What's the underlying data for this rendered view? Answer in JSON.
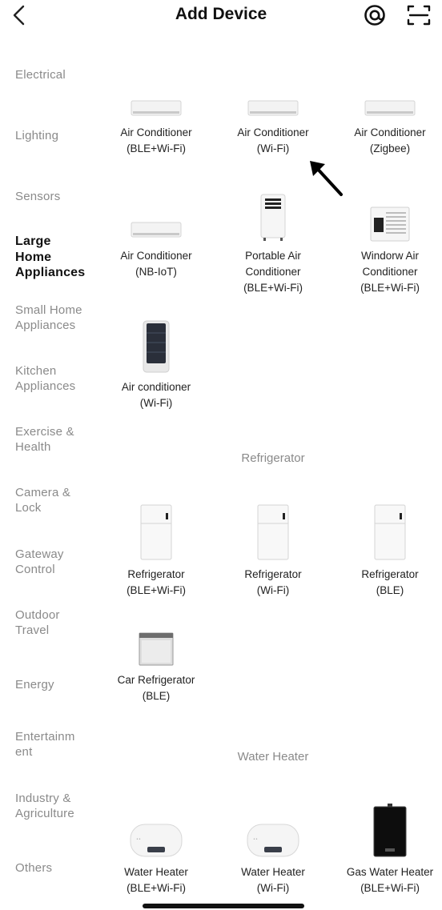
{
  "header": {
    "title": "Add Device"
  },
  "sidebar": {
    "categories": [
      "Electrical",
      "Lighting",
      "Sensors",
      "Large\nHome\nAppliances",
      "Small Home\nAppliances",
      "Kitchen\nAppliances",
      "Exercise &\nHealth",
      "Camera &\nLock",
      "Gateway\nControl",
      "Outdoor\nTravel",
      "Energy",
      "Entertainm\nent",
      "Industry &\nAgriculture",
      "Others"
    ],
    "active_index": 3
  },
  "sections": [
    {
      "title": "",
      "items": [
        {
          "name": "Air Conditioner\n(BLE+Wi-Fi)",
          "icon": "split-air-conditioner-icon"
        },
        {
          "name": "Air Conditioner\n(Wi-Fi)",
          "icon": "split-air-conditioner-icon"
        },
        {
          "name": "Air Conditioner\n(Zigbee)",
          "icon": "split-air-conditioner-icon"
        },
        {
          "name": "Air Conditioner\n(NB-IoT)",
          "icon": "split-air-conditioner-icon"
        },
        {
          "name": "Portable Air\nConditioner\n(BLE+Wi-Fi)",
          "icon": "portable-air-conditioner-icon"
        },
        {
          "name": "Windorw Air\nConditioner\n(BLE+Wi-Fi)",
          "icon": "window-air-conditioner-icon"
        },
        {
          "name": "Air conditioner\n(Wi-Fi)",
          "icon": "remote-control-icon"
        }
      ]
    },
    {
      "title": "Refrigerator",
      "items": [
        {
          "name": "Refrigerator\n(BLE+Wi-Fi)",
          "icon": "refrigerator-icon"
        },
        {
          "name": "Refrigerator\n(Wi-Fi)",
          "icon": "refrigerator-icon"
        },
        {
          "name": "Refrigerator\n(BLE)",
          "icon": "refrigerator-icon"
        },
        {
          "name": "Car Refrigerator\n(BLE)",
          "icon": "car-refrigerator-icon"
        }
      ]
    },
    {
      "title": "Water Heater",
      "items": [
        {
          "name": "Water Heater\n(BLE+Wi-Fi)",
          "icon": "water-heater-icon"
        },
        {
          "name": "Water Heater\n(Wi-Fi)",
          "icon": "water-heater-icon"
        },
        {
          "name": "Gas Water Heater\n(BLE+Wi-Fi)",
          "icon": "gas-water-heater-icon"
        }
      ]
    }
  ]
}
